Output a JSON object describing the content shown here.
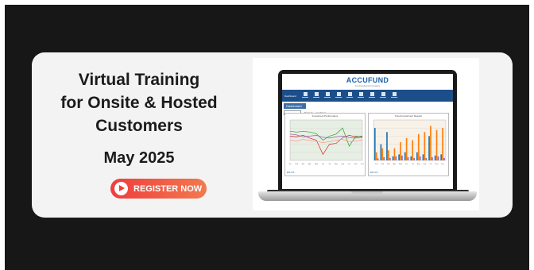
{
  "headline": {
    "lines": [
      "Virtual Training",
      "for Onsite & Hosted",
      "Customers"
    ],
    "date": "May 2025"
  },
  "cta": {
    "label": "REGISTER NOW",
    "icon": "play-icon",
    "color_start": "#ef3d3d",
    "color_end": "#f2794f"
  },
  "laptop_app": {
    "brand": "ACCUFUND",
    "brand_sub": "An AccuFund Company",
    "brand_color": "#1b5fa8",
    "nav_color": "#1c4f8a",
    "nav_label": "Dashboard",
    "nav_icons": [
      "home-icon",
      "admin-icon",
      "reports-icon",
      "budget-icon",
      "transactions-icon",
      "settings-icon",
      "users-icon",
      "help-icon",
      "exit-icon"
    ],
    "dashboard_tab": "Dashboard",
    "tools": [
      "Refresh",
      "Configure"
    ],
    "panels": [
      {
        "title": "Investment Performance",
        "footer": "EN-US",
        "chart_data": {
          "type": "line",
          "categories": [
            "Jan",
            "Feb",
            "Mar",
            "Apr",
            "May",
            "Jun",
            "Jul",
            "Aug",
            "Sep",
            "Oct",
            "Nov",
            "Dec"
          ],
          "ylim": [
            0,
            100
          ],
          "series": [
            {
              "color": "#d62728",
              "values": [
                60,
                58,
                62,
                55,
                50,
                15,
                40,
                42,
                56,
                62,
                58,
                60
              ]
            },
            {
              "color": "#2ca02c",
              "values": [
                72,
                70,
                72,
                70,
                66,
                50,
                60,
                65,
                80,
                35,
                60,
                58
              ]
            },
            {
              "color": "#ff9896",
              "values": [
                50,
                48,
                52,
                49,
                47,
                44,
                46,
                50,
                52,
                46,
                48,
                50
              ]
            },
            {
              "color": "#9467bd",
              "values": [
                65,
                63,
                58,
                60,
                62,
                57,
                55,
                58,
                60,
                56,
                55,
                57
              ]
            }
          ]
        }
      },
      {
        "title": "Fixed Investment Results",
        "footer": "EN-US",
        "chart_data": {
          "type": "bar",
          "categories": [
            "Jan",
            "Feb",
            "Mar",
            "Apr",
            "May",
            "Jun",
            "Jul",
            "Aug",
            "Sep",
            "Oct",
            "Nov",
            "Dec"
          ],
          "ylim": [
            0,
            100
          ],
          "series": [
            {
              "color": "#1f77b4",
              "values": [
                80,
                40,
                70,
                10,
                15,
                20,
                10,
                20,
                15,
                60,
                12,
                15
              ]
            },
            {
              "color": "#ff7f0e",
              "values": [
                20,
                30,
                25,
                30,
                45,
                55,
                50,
                65,
                70,
                85,
                75,
                80
              ]
            },
            {
              "color": "#9467bd",
              "values": [
                5,
                8,
                6,
                10,
                12,
                8,
                6,
                10,
                6,
                8,
                10,
                6
              ]
            }
          ]
        }
      }
    ]
  }
}
